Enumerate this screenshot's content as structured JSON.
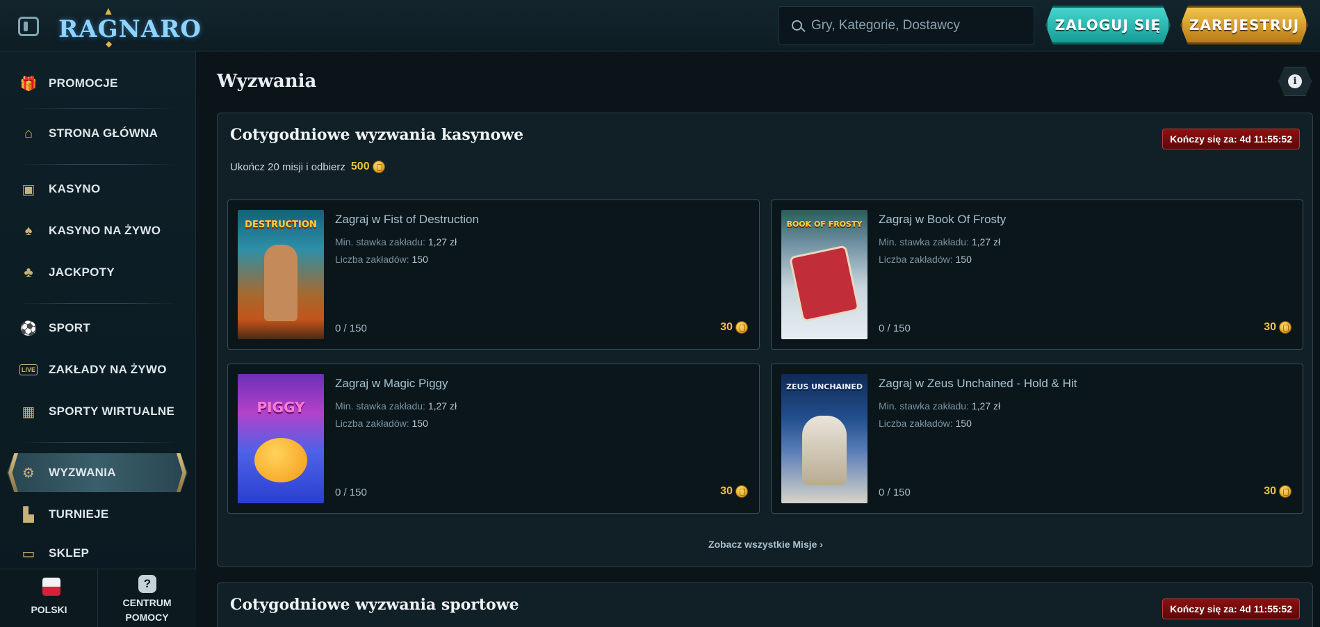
{
  "header": {
    "logo_text": "RAGNARO",
    "search_placeholder": "Gry, Kategorie, Dostawcy",
    "login_label": "ZALOGUJ SIĘ",
    "register_label": "ZAREJESTRUJ"
  },
  "sidebar": {
    "items": [
      {
        "label": "PROMOCJE",
        "icon": "gift-icon"
      },
      {
        "label": "STRONA GŁÓWNA",
        "icon": "home-icon"
      },
      {
        "label": "KASYNO",
        "icon": "slot-machine-icon"
      },
      {
        "label": "KASYNO NA ŻYWO",
        "icon": "cards-icon"
      },
      {
        "label": "JACKPOTY",
        "icon": "clover-icon"
      },
      {
        "label": "SPORT",
        "icon": "soccer-ball-icon"
      },
      {
        "label": "ZAKŁADY NA ŻYWO",
        "icon": "live-icon"
      },
      {
        "label": "SPORTY WIRTUALNE",
        "icon": "virtual-sport-icon"
      },
      {
        "label": "WYZWANIA",
        "icon": "gear-badge-icon"
      },
      {
        "label": "TURNIEJE",
        "icon": "podium-icon"
      },
      {
        "label": "SKLEP",
        "icon": "briefcase-icon"
      }
    ],
    "active": "WYZWANIA",
    "live_badge": "LIVE",
    "language_label": "POLSKI",
    "help_label_line1": "CENTRUM",
    "help_label_line2": "POMOCY"
  },
  "main": {
    "page_title": "Wyzwania",
    "casino_panel": {
      "title": "Cotygodniowe wyzwania kasynowe",
      "timer": "Kończy się za: 4d 11:55:52",
      "subtitle": "Ukończ 20 misji i odbierz",
      "reward": "500",
      "see_all": "Zobacz wszystkie Misje ›",
      "cards": [
        {
          "title": "Zagraj w Fist of Destruction",
          "min_bet_label": "Min. stawka zakładu:",
          "min_bet": "1,27 zł",
          "count_label": "Liczba zakładów:",
          "count": "150",
          "progress": "0 / 150",
          "reward": "30",
          "thumb_text": "DESTRUCTION"
        },
        {
          "title": "Zagraj w Book Of Frosty",
          "min_bet_label": "Min. stawka zakładu:",
          "min_bet": "1,27 zł",
          "count_label": "Liczba zakładów:",
          "count": "150",
          "progress": "0 / 150",
          "reward": "30",
          "thumb_text": "BOOK OF FROSTY"
        },
        {
          "title": "Zagraj w Magic Piggy",
          "min_bet_label": "Min. stawka zakładu:",
          "min_bet": "1,27 zł",
          "count_label": "Liczba zakładów:",
          "count": "150",
          "progress": "0 / 150",
          "reward": "30",
          "thumb_text": "PIGGY"
        },
        {
          "title": "Zagraj w Zeus Unchained - Hold & Hit",
          "min_bet_label": "Min. stawka zakładu:",
          "min_bet": "1,27 zł",
          "count_label": "Liczba zakładów:",
          "count": "150",
          "progress": "0 / 150",
          "reward": "30",
          "thumb_text": "ZEUS UNCHAINED"
        }
      ]
    },
    "sport_panel": {
      "title": "Cotygodniowe wyzwania sportowe",
      "timer": "Kończy się za: 4d 11:55:52"
    }
  },
  "colors": {
    "accent_gold": "#f2c23a",
    "timer_red": "#8c1010",
    "login_teal": "#2fbcb3",
    "register_gold": "#e0a726"
  }
}
